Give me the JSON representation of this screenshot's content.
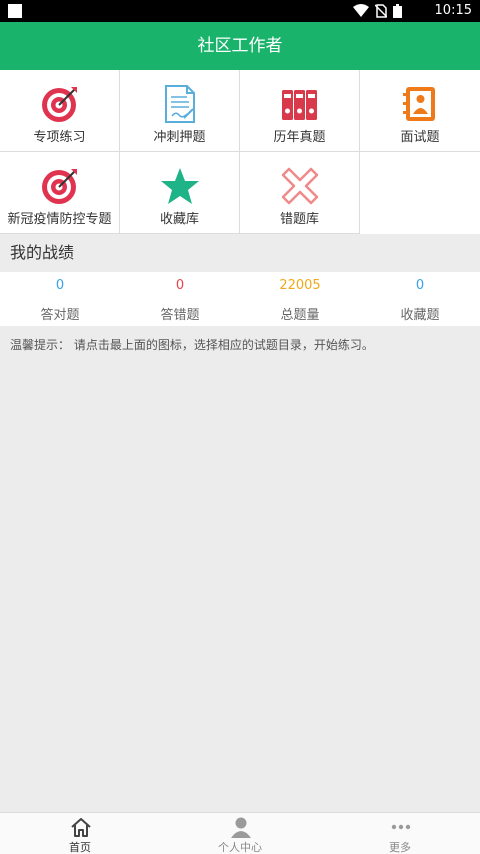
{
  "status_bar": {
    "time": "10:15"
  },
  "app_bar": {
    "title": "社区工作者"
  },
  "grid": {
    "items": [
      {
        "label": "专项练习",
        "icon": "target-icon"
      },
      {
        "label": "冲刺押题",
        "icon": "document-icon"
      },
      {
        "label": "历年真题",
        "icon": "binders-icon"
      },
      {
        "label": "面试题",
        "icon": "contact-book-icon"
      },
      {
        "label": "新冠疫情防控专题",
        "icon": "target-icon"
      },
      {
        "label": "收藏库",
        "icon": "star-icon"
      },
      {
        "label": "错题库",
        "icon": "wrong-x-icon"
      }
    ]
  },
  "stats": {
    "title": "我的战绩",
    "items": [
      {
        "value": "0",
        "label": "答对题",
        "color": "#3aa0e6"
      },
      {
        "value": "0",
        "label": "答错题",
        "color": "#e8434d"
      },
      {
        "value": "22005",
        "label": "总题量",
        "color": "#f0a91a"
      },
      {
        "value": "0",
        "label": "收藏题",
        "color": "#3aa0e6"
      }
    ]
  },
  "tip": "温馨提示： 请点击最上面的图标，选择相应的试题目录，开始练习。",
  "bottom_nav": {
    "items": [
      {
        "label": "首页",
        "icon": "home-icon",
        "active": true
      },
      {
        "label": "个人中心",
        "icon": "person-icon",
        "active": false
      },
      {
        "label": "更多",
        "icon": "more-icon",
        "active": false
      }
    ]
  },
  "colors": {
    "brand": "#19b36b",
    "target": "#e0334f",
    "doc": "#5aaede",
    "binder": "#d83a4c",
    "contact": "#ef7a1a",
    "star": "#1fb487",
    "wrong": "#f08a8a"
  }
}
